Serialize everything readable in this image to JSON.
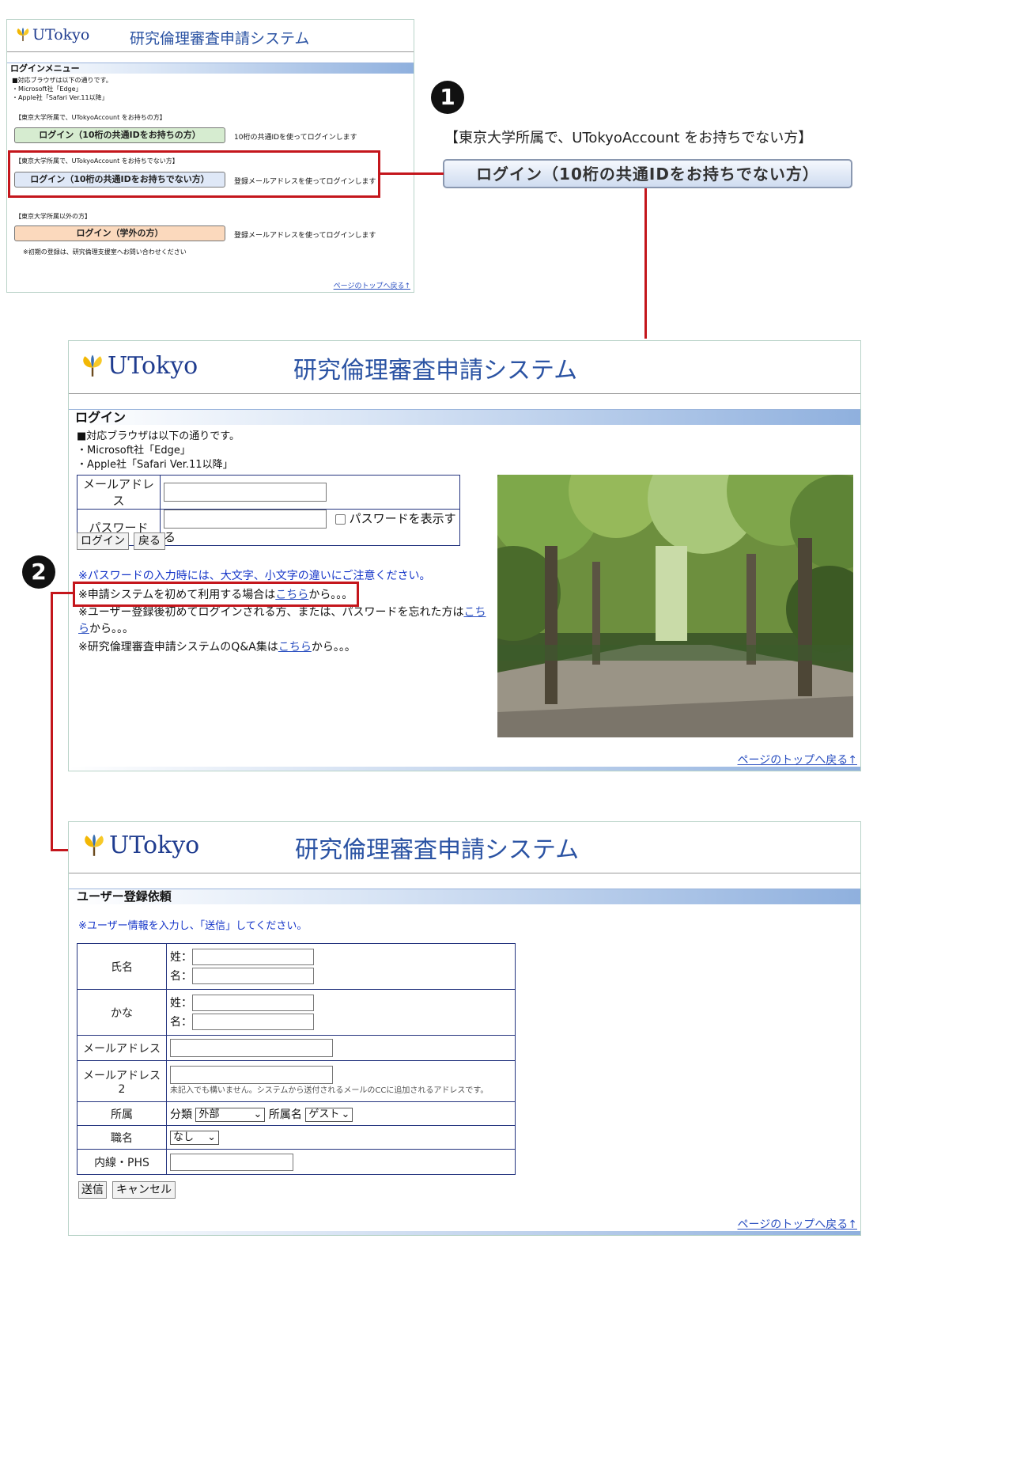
{
  "panel1": {
    "logo_text": "UTokyo",
    "system_title": "研究倫理審査申請システム",
    "section_title": "ログインメニュー",
    "browser_note": [
      "■対応ブラウザは以下の通りです。",
      "・Microsoft社「Edge」",
      "・Apple社「Safari Ver.11以降」"
    ],
    "group1_label": "【東京大学所属で、UTokyoAccount をお持ちの方】",
    "group1_button": "ログイン（10桁の共通IDをお持ちの方）",
    "group1_desc": "10桁の共通IDを使ってログインします",
    "group2_label": "【東京大学所属で、UTokyoAccount をお持ちでない方】",
    "group2_button": "ログイン（10桁の共通IDをお持ちでない方）",
    "group2_desc": "登録メールアドレスを使ってログインします",
    "group3_label": "【東京大学所属以外の方】",
    "group3_button": "ログイン（学外の方）",
    "group3_desc": "登録メールアドレスを使ってログインします",
    "footnote": "※初期の登録は、研究倫理支援室へお問い合わせください",
    "top_link": "ページのトップへ戻る↑"
  },
  "callout1": {
    "number": "1",
    "label": "【東京大学所属で、UTokyoAccount をお持ちでない方】",
    "button": "ログイン（10桁の共通IDをお持ちでない方）"
  },
  "panel2": {
    "logo_text": "UTokyo",
    "system_title": "研究倫理審査申請システム",
    "section_title": "ログイン",
    "browser_note": [
      "■対応ブラウザは以下の通りです。",
      "・Microsoft社「Edge」",
      "・Apple社「Safari Ver.11以降」"
    ],
    "email_label": "メールアドレス",
    "email_value": "",
    "password_label": "パスワード",
    "password_value": "",
    "show_password_label": "パスワードを表示する",
    "login_button": "ログイン",
    "back_button": "戻る",
    "notice_case": "※パスワードの入力時には、大文字、小文字の違いにご注意ください。",
    "line1_pre": "※申請システムを初めて利用する場合は",
    "line1_link": "こちら",
    "line1_post": "から。。。",
    "line2_pre": "※ユーザー登録後初めてログインされる方、または、パスワードを忘れた方は",
    "line2_link": "こちら",
    "line2_post": "から。。。",
    "line3_pre": "※研究倫理審査申請システムのQ&A集は",
    "line3_link": "こちら",
    "line3_post": "から。。。",
    "top_link": "ページのトップへ戻る↑"
  },
  "callout2": {
    "number": "2"
  },
  "panel3": {
    "logo_text": "UTokyo",
    "system_title": "研究倫理審査申請システム",
    "section_title": "ユーザー登録依頼",
    "instruction": "※ユーザー情報を入力し、「送信」してください。",
    "name_label": "氏名",
    "kana_label": "かな",
    "sei": "姓：",
    "mei": "名：",
    "email_label": "メールアドレス",
    "email2_label": "メールアドレス2",
    "email2_note": "未記入でも構いません。システムから送付されるメールのCCに追加されるアドレスです。",
    "affiliation_label": "所属",
    "category_label": "分類",
    "category_value": "外部",
    "affiliation_name_label": "所属名",
    "affiliation_name_value": "ゲスト",
    "position_label": "職名",
    "position_value": "なし",
    "phone_label": "内線・PHS",
    "send_button": "送信",
    "cancel_button": "キャンセル",
    "top_link": "ページのトップへ戻る↑"
  },
  "colors": {
    "accent_red": "#c4161c",
    "title_blue": "#2b53a3",
    "button_green": "#d6ecd0",
    "button_blue": "#dfe8f7",
    "button_orange": "#fbd9bd"
  }
}
